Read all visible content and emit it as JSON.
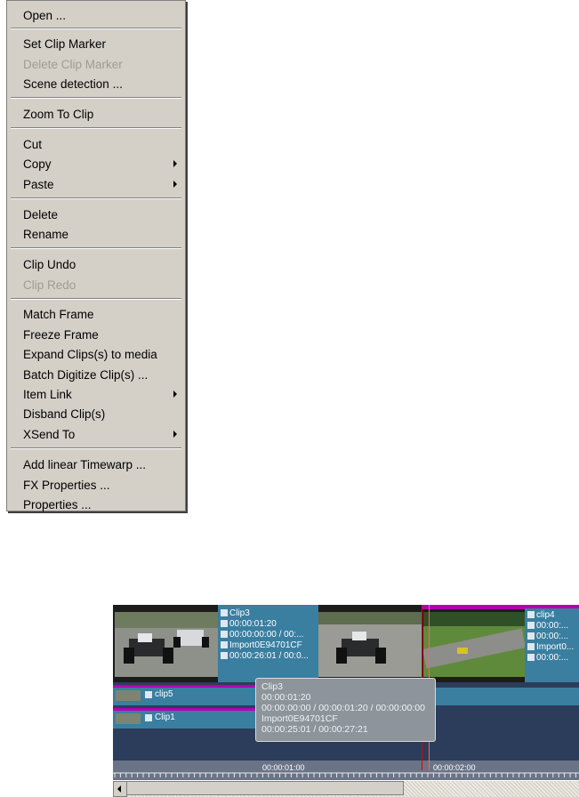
{
  "menu": {
    "items": [
      {
        "label": "Open ...",
        "enabled": true,
        "submenu": false
      },
      {
        "label": "Set Clip Marker",
        "enabled": true,
        "submenu": false
      },
      {
        "label": "Delete Clip Marker",
        "enabled": false,
        "submenu": false
      },
      {
        "label": "Scene detection ...",
        "enabled": true,
        "submenu": false
      },
      {
        "label": "Zoom To Clip",
        "enabled": true,
        "submenu": false
      },
      {
        "label": "Cut",
        "enabled": true,
        "submenu": false
      },
      {
        "label": "Copy",
        "enabled": true,
        "submenu": true
      },
      {
        "label": "Paste",
        "enabled": true,
        "submenu": true
      },
      {
        "label": "Delete",
        "enabled": true,
        "submenu": false
      },
      {
        "label": "Rename",
        "enabled": true,
        "submenu": false
      },
      {
        "label": "Clip Undo",
        "enabled": true,
        "submenu": false
      },
      {
        "label": "Clip Redo",
        "enabled": false,
        "submenu": false
      },
      {
        "label": "Match Frame",
        "enabled": true,
        "submenu": false
      },
      {
        "label": "Freeze Frame",
        "enabled": true,
        "submenu": false
      },
      {
        "label": "Expand Clips(s) to media",
        "enabled": true,
        "submenu": false
      },
      {
        "label": "Batch Digitize Clip(s) ...",
        "enabled": true,
        "submenu": false
      },
      {
        "label": "Item Link",
        "enabled": true,
        "submenu": true
      },
      {
        "label": "Disband Clip(s)",
        "enabled": true,
        "submenu": false
      },
      {
        "label": "XSend To",
        "enabled": true,
        "submenu": true
      },
      {
        "label": "Add linear Timewarp ...",
        "enabled": true,
        "submenu": false
      },
      {
        "label": "FX Properties ...",
        "enabled": true,
        "submenu": false
      },
      {
        "label": "Properties ...",
        "enabled": true,
        "submenu": false
      }
    ]
  },
  "timeline": {
    "clip3": {
      "name": "Clip3",
      "duration": "00:00:01:20",
      "inout": "00:00:00:00 / 00:...",
      "source": "Import0E94701CF",
      "timecode": "00:00:26:01 / 00:0..."
    },
    "clip4": {
      "name": "clip4",
      "duration": "00:00:...",
      "inout": "00:00:...",
      "source": "Import0...",
      "timecode": "00:00:..."
    },
    "clip5": {
      "name": "clip5"
    },
    "clip1": {
      "name": "Clip1"
    },
    "ruler": {
      "mark1": "00:00:01:00",
      "mark2": "00:00:02:00"
    },
    "tooltip": {
      "line1": "Clip3",
      "line2": "00:00:01:20",
      "line3": "00:00:00:00 /  00:00:01:20 / 00:00:00:00",
      "line4": "Import0E94701CF",
      "line5": "00:00:25:01 / 00:00:27:21"
    },
    "colors": {
      "clip": "#3a7ea0",
      "marker": "#b400b4",
      "playhead": "#e00000",
      "track": "#2c3d5b"
    }
  }
}
